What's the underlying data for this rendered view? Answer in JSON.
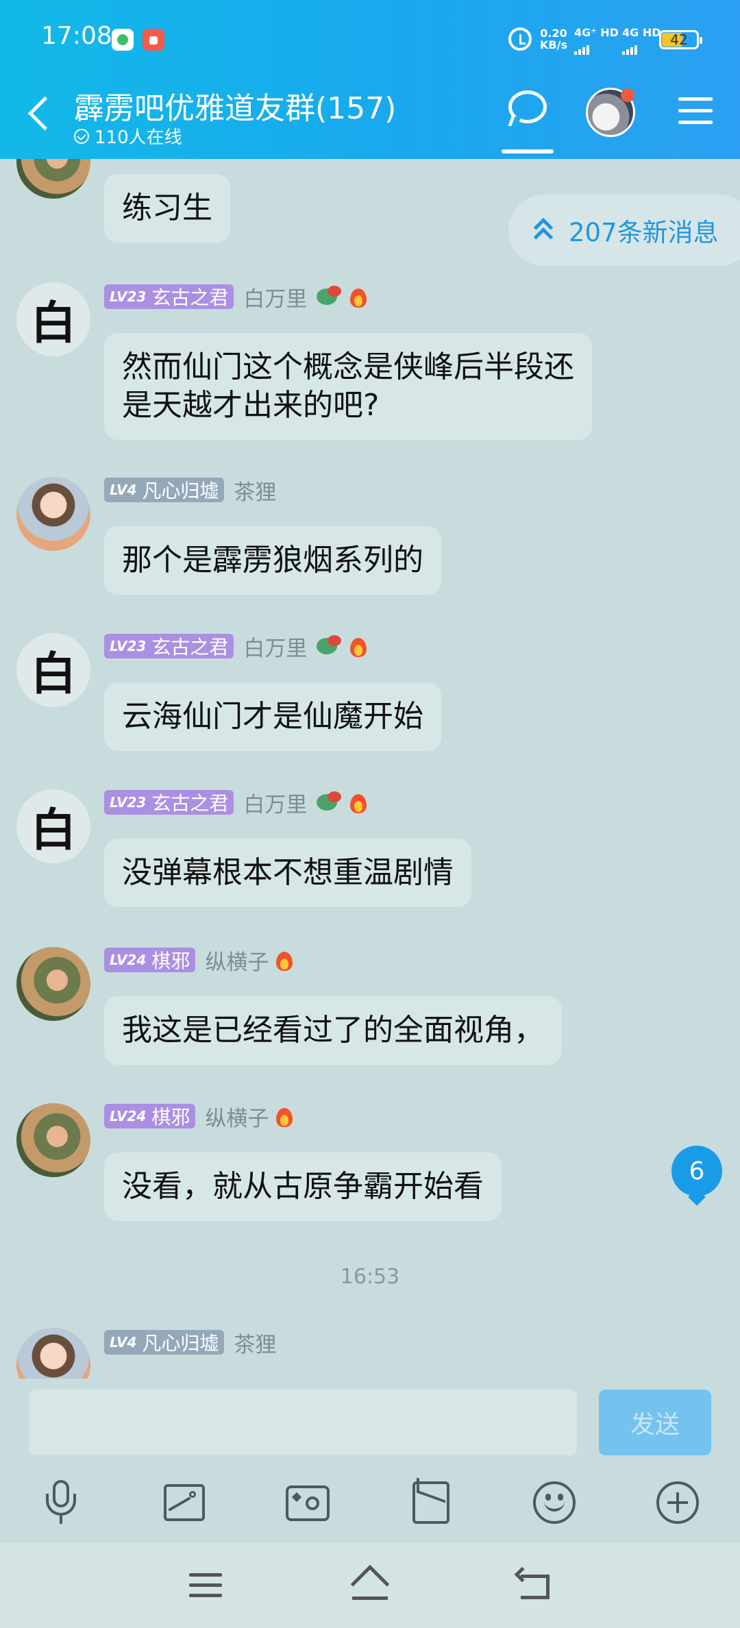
{
  "status_bar": {
    "time": "17:08",
    "net_speed": "0.20",
    "net_speed_unit": "KB/s",
    "signal_1": "4G⁺ HD",
    "signal_2": "4G HD",
    "battery": "42"
  },
  "header": {
    "title": "霹雳吧优雅道友群(157)",
    "online": "110人在线"
  },
  "new_messages": "207条新消息",
  "messages": [
    {
      "level": "",
      "title": "",
      "nick": "",
      "text": "练习生",
      "avatar": "qixie"
    },
    {
      "level": "LV23",
      "title": "玄古之君",
      "nick": "白万里",
      "text_lines": [
        "然而仙门这个概念是侠峰后半段还",
        "是天越才出来的吧?"
      ],
      "avatar": "bai"
    },
    {
      "level": "LV4",
      "title": "凡心归墟",
      "nick": "茶狸",
      "text": "那个是霹雳狼烟系列的",
      "avatar": "fanxin"
    },
    {
      "level": "LV23",
      "title": "玄古之君",
      "nick": "白万里",
      "text": "云海仙门才是仙魔开始",
      "avatar": "bai"
    },
    {
      "level": "LV23",
      "title": "玄古之君",
      "nick": "白万里",
      "text": "没弹幕根本不想重温剧情",
      "avatar": "bai"
    },
    {
      "level": "LV24",
      "title": "棋邪",
      "nick": "纵横子",
      "text": "我这是已经看过了的全面视角，",
      "avatar": "qixie"
    },
    {
      "level": "LV24",
      "title": "棋邪",
      "nick": "纵横子",
      "text": "没看，就从古原争霸开始看",
      "avatar": "qixie"
    },
    {
      "level": "LV4",
      "title": "凡心归墟",
      "nick": "茶狸",
      "text": "",
      "avatar": "fanxin"
    }
  ],
  "avatar_char": "白",
  "time_divider": "16:53",
  "unread_count": "6",
  "input": {
    "value": "",
    "send_label": "发送"
  },
  "colors": {
    "header_gradient_start": "#12b9e8",
    "header_gradient_end": "#2ba0f2",
    "accent": "#2196e0",
    "badge_purple": "#ab8fe2",
    "badge_grey": "#95a8ba",
    "chat_bg": "#c8dcdd",
    "bubble_bg": "#d7e7e8"
  },
  "icons": {
    "toolbar": [
      "mic-icon",
      "image-icon",
      "camera-icon",
      "red-packet-icon",
      "emoji-icon",
      "plus-icon"
    ],
    "nav": [
      "menu-icon",
      "home-icon",
      "back-icon"
    ]
  }
}
